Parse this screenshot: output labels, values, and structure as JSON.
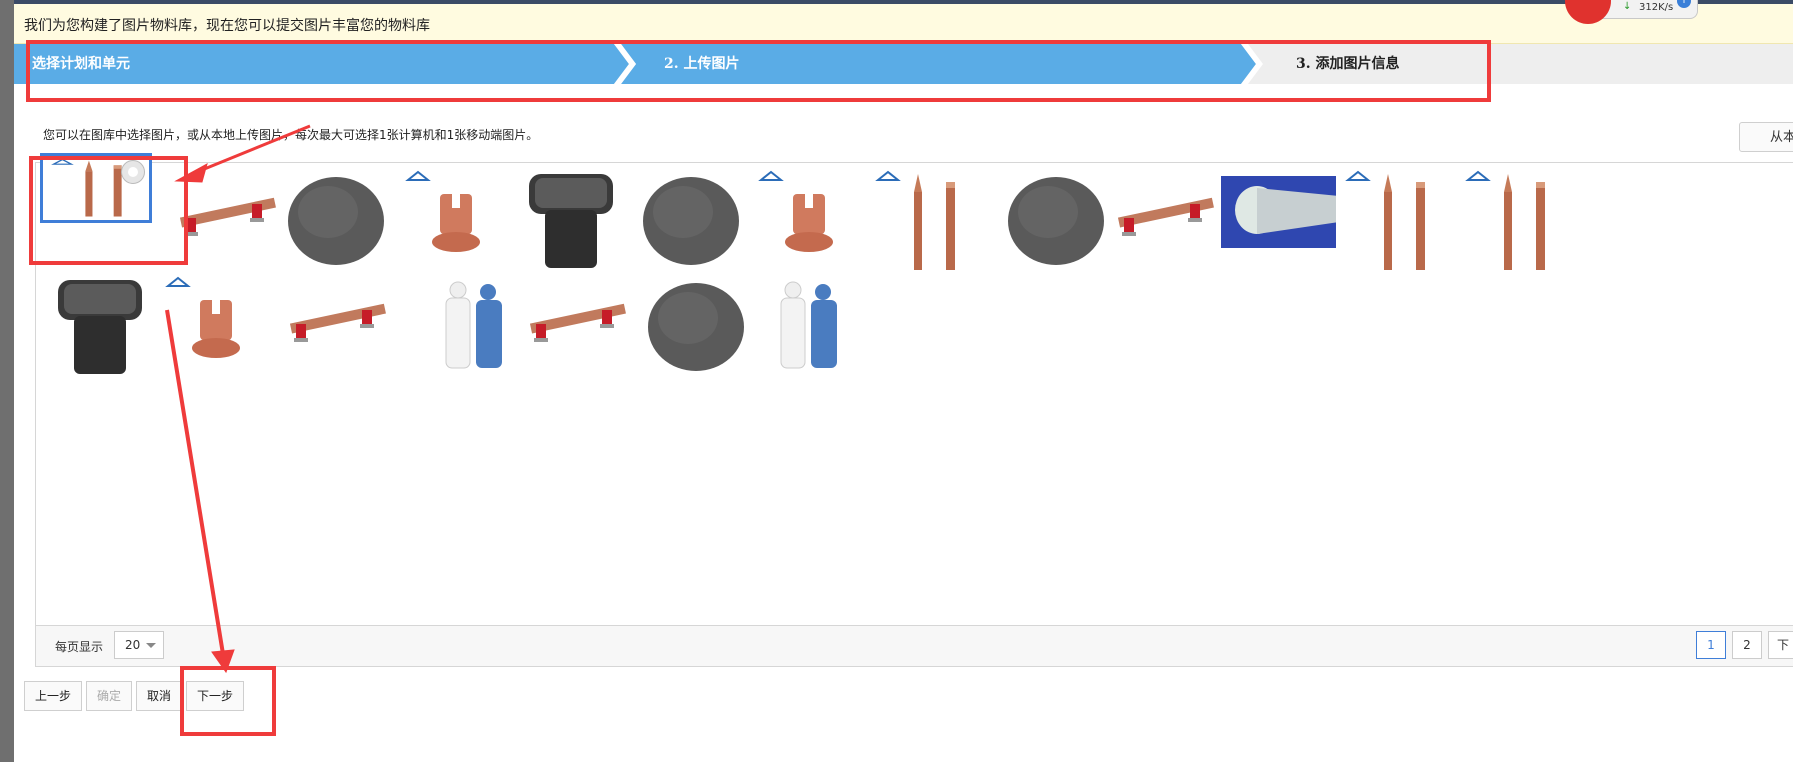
{
  "notice": {
    "text": "我们为您构建了图片物料库，现在您可以提交图片丰富您的物料库"
  },
  "speed_widget": {
    "speed": "312K/s"
  },
  "steps": [
    {
      "label": "选择计划和单元"
    },
    {
      "label": "2. 上传图片"
    },
    {
      "label": "3. 添加图片信息"
    }
  ],
  "instruction": "您可以在图库中选择图片，或从本地上传图片，每次最大可选择1张计算机和1张移动端图片。",
  "upload_local_label": "从本",
  "gallery": {
    "items": [
      {
        "type": "copper-rods",
        "selected": true
      },
      {
        "type": "busbar"
      },
      {
        "type": "powder"
      },
      {
        "type": "copper-clamp"
      },
      {
        "type": "pit-box"
      },
      {
        "type": "powder"
      },
      {
        "type": "copper-clamp"
      },
      {
        "type": "copper-rods"
      },
      {
        "type": "powder"
      },
      {
        "type": "busbar"
      },
      {
        "type": "cable"
      },
      {
        "type": "copper-rods"
      },
      {
        "type": "copper-rods"
      },
      {
        "type": "pit-box"
      },
      {
        "type": "copper-clamp"
      },
      {
        "type": "busbar"
      },
      {
        "type": "workers"
      },
      {
        "type": "busbar"
      },
      {
        "type": "powder"
      },
      {
        "type": "workers"
      }
    ]
  },
  "pager": {
    "per_page_label": "每页显示",
    "per_page_value": "20",
    "pages": [
      "1",
      "2",
      "下"
    ],
    "current_page": "1"
  },
  "actions": {
    "prev": "上一步",
    "confirm": "确定",
    "cancel": "取消",
    "next": "下一步"
  },
  "colors": {
    "step_active": "#5aace6",
    "annotation": "#ef3b3b",
    "selected_border": "#3f7ed8"
  }
}
